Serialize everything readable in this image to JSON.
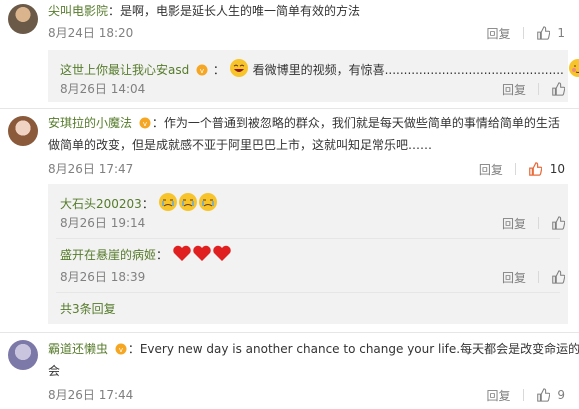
{
  "comments": [
    {
      "user": "尖叫电影院",
      "text": "：是啊，电影是延长人生的唯一简单有效的方法",
      "time": "8月24日 18:20",
      "reply_label": "回复",
      "likes": "1"
    },
    {
      "user": "安琪拉的小魔法",
      "text_line1": "：作为一个普通到被忽略的群众，我们就是每天做些简单的事情给简单的生活",
      "text_line2": "做简单的改变，但是成就感不亚于阿里巴巴上市，这就叫知足常乐吧……",
      "time": "8月26日 17:47",
      "reply_label": "回复",
      "likes": "10",
      "replies": [
        {
          "user": "大石头200203",
          "text": "：",
          "time": "8月26日 19:14",
          "reply_label": "回复",
          "likes": ""
        },
        {
          "user": "盛开在悬崖的病姬",
          "text": "：",
          "time": "8月26日 18:39",
          "reply_label": "回复",
          "likes": ""
        }
      ],
      "more_replies": "共3条回复"
    },
    {
      "user": "霸道还懒虫",
      "text_line1": "：Every new day is another chance to change your life.每天都会是改变命运的机",
      "text_line2": "会",
      "time": "8月26日 17:44",
      "reply_label": "回复",
      "likes": "9"
    }
  ],
  "nested_first": {
    "user": "这世上你最让我心安asd",
    "text": "看微博里的视频，有惊喜...............................................",
    "time": "8月26日 14:04",
    "reply_label": "回复",
    "likes": ""
  },
  "colors": {
    "link": "#567b2b",
    "like_active": "#e86b3a",
    "gray": "#808080",
    "reply_bg": "#f2f2f2"
  }
}
